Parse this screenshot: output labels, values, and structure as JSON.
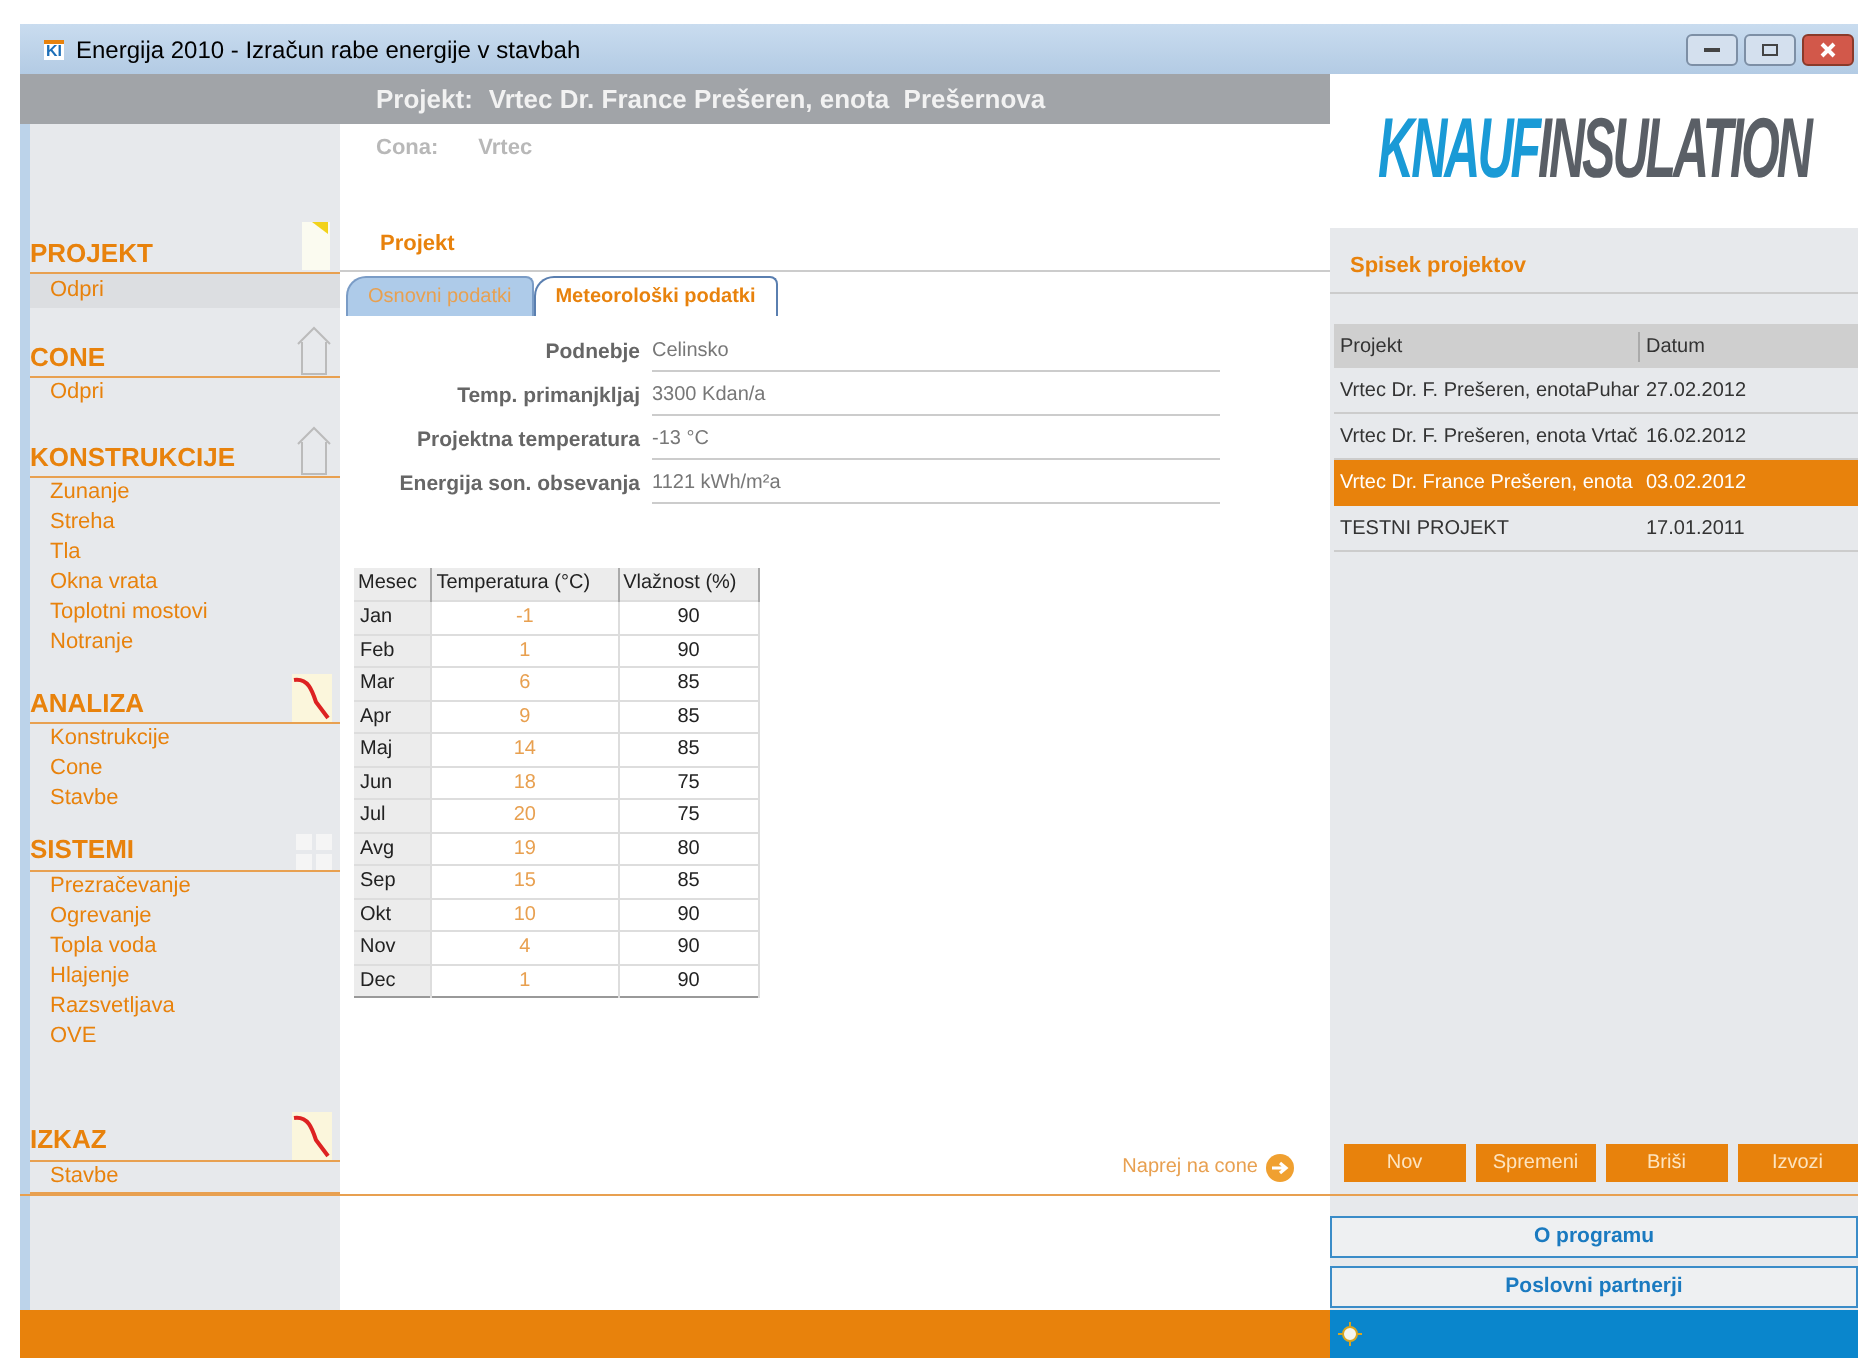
{
  "window": {
    "app_icon": "KI",
    "title": "Energija 2010 - Izračun rabe energije v stavbah"
  },
  "header": {
    "project_label": "Projekt:",
    "project_name": "Vrtec Dr. France Prešeren, enota  Prešernova",
    "zone_label": "Cona:",
    "zone_value": "Vrtec"
  },
  "logo": {
    "brand": "KNAUF",
    "sub": "INSULATION"
  },
  "sidebar": [
    {
      "title": "PROJEKT",
      "items": [
        {
          "label": "Odpri",
          "selected": true
        }
      ]
    },
    {
      "title": "CONE",
      "items": [
        {
          "label": "Odpri",
          "selected": false
        }
      ]
    },
    {
      "title": "KONSTRUKCIJE",
      "items": [
        {
          "label": "Zunanje",
          "selected": false
        },
        {
          "label": "Streha",
          "selected": false
        },
        {
          "label": "Tla",
          "selected": false
        },
        {
          "label": "Okna vrata",
          "selected": false
        },
        {
          "label": "Toplotni mostovi",
          "selected": false
        },
        {
          "label": "Notranje",
          "selected": false
        }
      ]
    },
    {
      "title": "ANALIZA",
      "items": [
        {
          "label": "Konstrukcije",
          "selected": false
        },
        {
          "label": "Cone",
          "selected": false
        },
        {
          "label": "Stavbe",
          "selected": false
        }
      ]
    },
    {
      "title": "SISTEMI",
      "items": [
        {
          "label": "Prezračevanje",
          "selected": false
        },
        {
          "label": "Ogrevanje",
          "selected": false
        },
        {
          "label": "Topla voda",
          "selected": false
        },
        {
          "label": "Hlajenje",
          "selected": false
        },
        {
          "label": "Razsvetljava",
          "selected": false
        },
        {
          "label": "OVE",
          "selected": false
        }
      ]
    },
    {
      "title": "IZKAZ",
      "items": [
        {
          "label": "Stavbe",
          "selected": false
        }
      ]
    }
  ],
  "section_title": "Projekt",
  "tabs": [
    {
      "label": "Osnovni podatki",
      "selected": false
    },
    {
      "label": "Meteorološki podatki",
      "selected": true
    }
  ],
  "fields": [
    {
      "label": "Podnebje",
      "value": "Celinsko"
    },
    {
      "label": "Temp. primanjkljaj",
      "value": "3300 Kdan/a"
    },
    {
      "label": "Projektna temperatura",
      "value": "-13 °C"
    },
    {
      "label": "Energija son. obsevanja",
      "value": "1121 kWh/m²a"
    }
  ],
  "climate_table": {
    "columns": [
      "Mesec",
      "Temperatura (°C)",
      "Vlažnost (%)"
    ],
    "rows": [
      [
        "Jan",
        "-1",
        "90"
      ],
      [
        "Feb",
        "1",
        "90"
      ],
      [
        "Mar",
        "6",
        "85"
      ],
      [
        "Apr",
        "9",
        "85"
      ],
      [
        "Maj",
        "14",
        "85"
      ],
      [
        "Jun",
        "18",
        "75"
      ],
      [
        "Jul",
        "20",
        "75"
      ],
      [
        "Avg",
        "19",
        "80"
      ],
      [
        "Sep",
        "15",
        "85"
      ],
      [
        "Okt",
        "10",
        "90"
      ],
      [
        "Nov",
        "4",
        "90"
      ],
      [
        "Dec",
        "1",
        "90"
      ]
    ]
  },
  "next_link": "Naprej na cone",
  "project_list": {
    "title": "Spisek projektov",
    "columns": [
      "Projekt",
      "Datum"
    ],
    "rows": [
      {
        "name": "Vrtec Dr. F. Prešeren, enotaPuhar",
        "date": "27.02.2012",
        "selected": false
      },
      {
        "name": "Vrtec Dr. F. Prešeren, enota Vrtač",
        "date": "16.02.2012",
        "selected": false
      },
      {
        "name": "Vrtec Dr. France Prešeren, enota",
        "date": "03.02.2012",
        "selected": true
      },
      {
        "name": "TESTNI PROJEKT",
        "date": "17.01.2011",
        "selected": false
      }
    ],
    "buttons": [
      "Nov",
      "Spremeni",
      "Briši",
      "Izvozi"
    ]
  },
  "bottom_buttons": [
    "O programu",
    "Poslovni partnerji"
  ]
}
